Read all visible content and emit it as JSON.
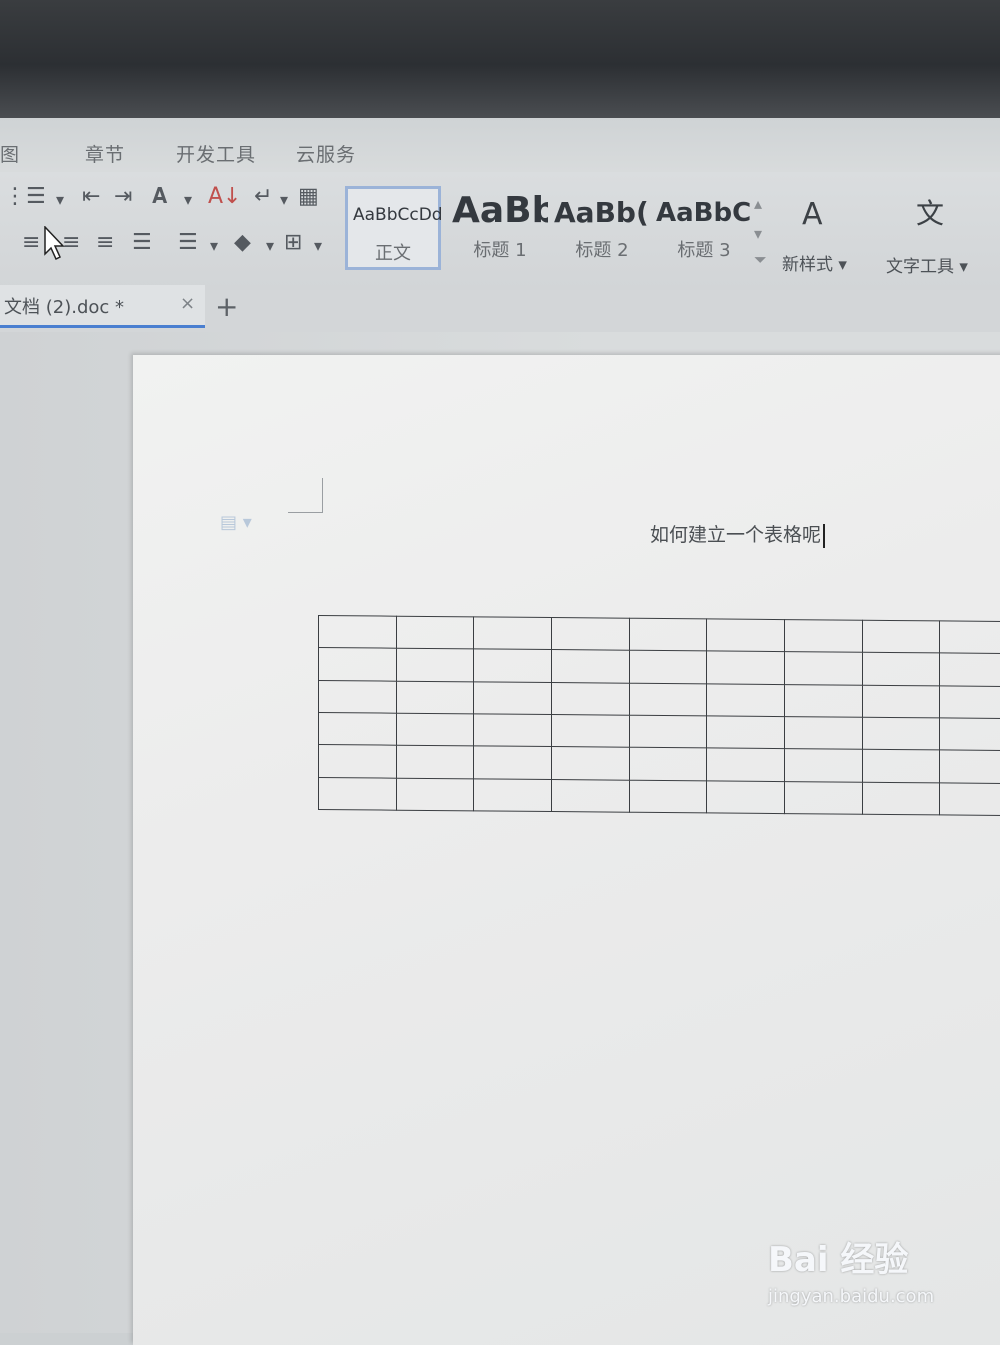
{
  "menu": {
    "items": [
      "图",
      "章节",
      "开发工具",
      "云服务"
    ]
  },
  "styles": [
    {
      "sample": "AaBbCcDd",
      "name": "正文"
    },
    {
      "sample": "AaBb",
      "name": "标题 1"
    },
    {
      "sample": "AaBb(",
      "name": "标题 2"
    },
    {
      "sample": "AaBbC",
      "name": "标题 3"
    }
  ],
  "new_style": {
    "label": "新样式 ▾"
  },
  "text_tools": {
    "label": "文字工具 ▾"
  },
  "tab": {
    "label": "文档 (2).doc *",
    "close": "×",
    "add": "+"
  },
  "document": {
    "heading": "如何建立一个表格呢",
    "table": {
      "rows": 6,
      "cols": 9
    }
  },
  "watermark": {
    "main": "Bai 经验",
    "url": "jingyan.baidu.com"
  }
}
